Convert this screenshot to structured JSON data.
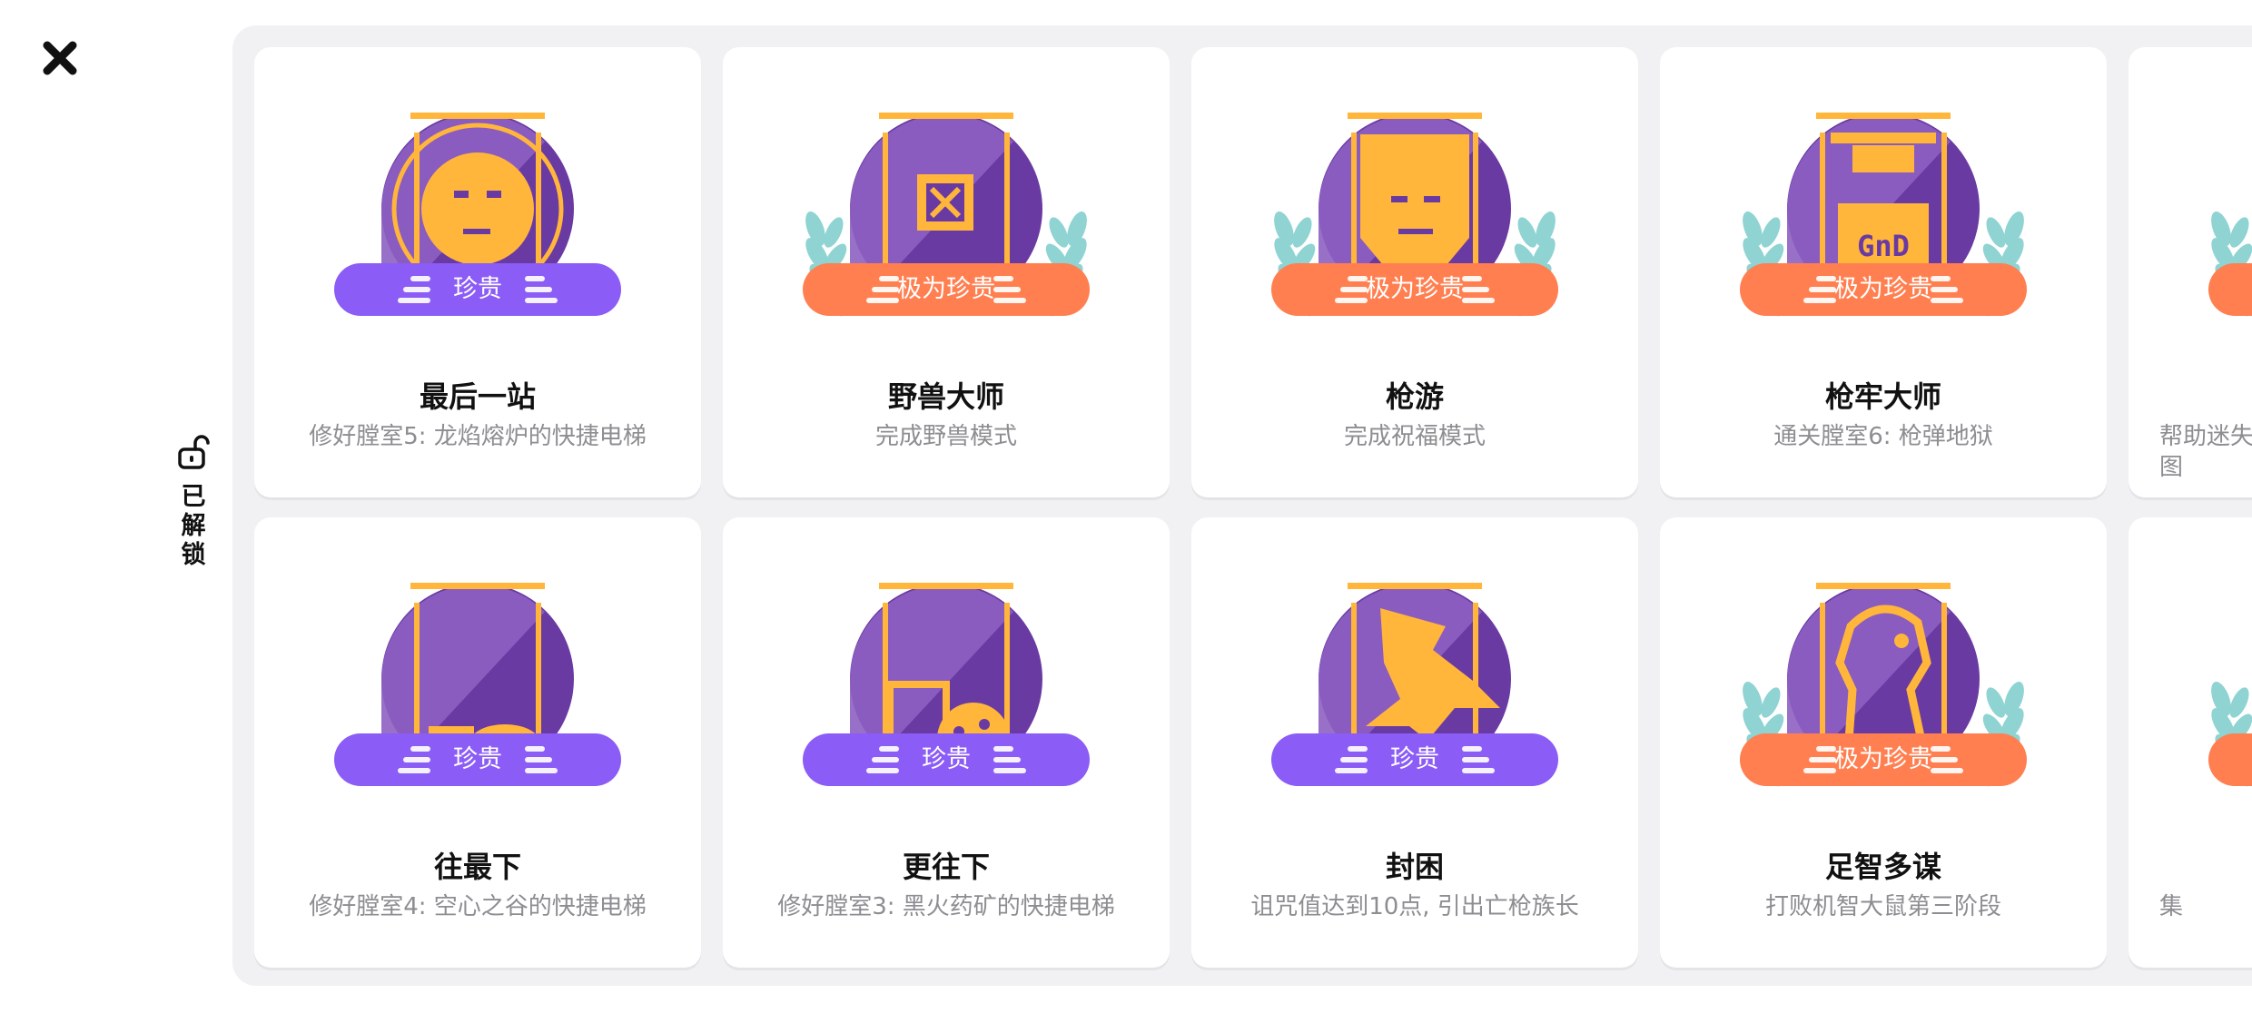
{
  "sidebar": {
    "tab_label": "已解锁"
  },
  "colors": {
    "rare": "#8b5cf6",
    "epic": "#ff7f50",
    "disc_purple": "#6a3aa3",
    "disc_gold": "#ffb63b",
    "laurel": "#8fd3d3"
  },
  "achievements": [
    {
      "title": "最后一站",
      "desc": "修好膛室5: 龙焰熔炉的快捷电梯",
      "rarity": "珍贵",
      "tier": "rare",
      "laurel": false,
      "icon": "coin-face-icon"
    },
    {
      "title": "野兽大师",
      "desc": "完成野兽模式",
      "rarity": "极为珍贵",
      "tier": "epic",
      "laurel": true,
      "icon": "crossed-box-icon"
    },
    {
      "title": "枪游",
      "desc": "完成祝福模式",
      "rarity": "极为珍贵",
      "tier": "epic",
      "laurel": true,
      "icon": "block-face-icon"
    },
    {
      "title": "枪牢大师",
      "desc": "通关膛室6: 枪弹地狱",
      "rarity": "极为珍贵",
      "tier": "epic",
      "laurel": true,
      "icon": "gnd-skull-icon"
    },
    {
      "title": "",
      "desc": "帮助迷失\n图",
      "rarity": "",
      "tier": "epic",
      "laurel": true,
      "icon": "partial-badge-icon",
      "cut": true
    },
    {
      "title": "往最下",
      "desc": "修好膛室4: 空心之谷的快捷电梯",
      "rarity": "珍贵",
      "tier": "rare",
      "laurel": false,
      "icon": "hollow-cart-icon"
    },
    {
      "title": "更往下",
      "desc": "修好膛室3: 黑火药矿的快捷电梯",
      "rarity": "珍贵",
      "tier": "rare",
      "laurel": false,
      "icon": "mine-cart-icon"
    },
    {
      "title": "封困",
      "desc": "诅咒值达到10点, 引出亡枪族长",
      "rarity": "珍贵",
      "tier": "rare",
      "laurel": false,
      "icon": "dragon-icon"
    },
    {
      "title": "足智多谋",
      "desc": "打败机智大鼠第三阶段",
      "rarity": "极为珍贵",
      "tier": "epic",
      "laurel": true,
      "icon": "rat-icon"
    },
    {
      "title": "",
      "desc": "集",
      "rarity": "",
      "tier": "epic",
      "laurel": true,
      "icon": "partial-badge-icon",
      "cut": true
    }
  ]
}
